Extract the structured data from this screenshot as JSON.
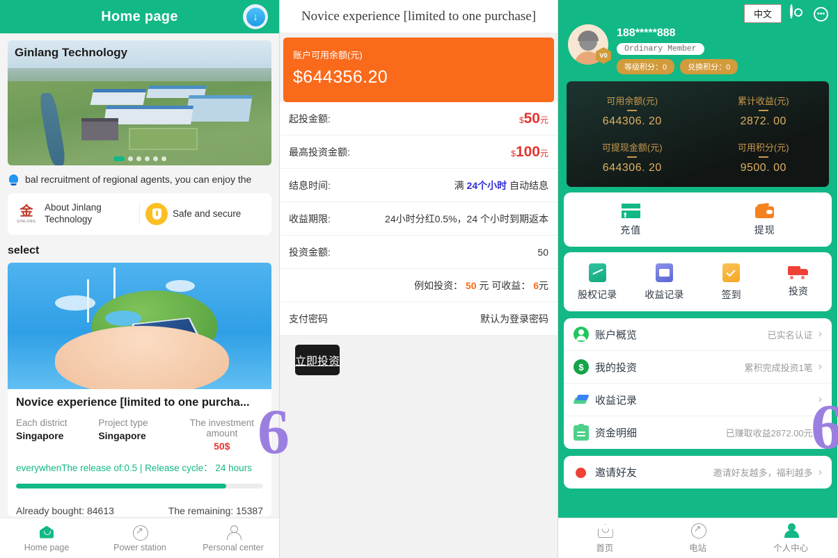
{
  "home": {
    "header_title": "Home page",
    "download_icon": "download-arrow-icon",
    "banner": {
      "logo_text": "Ginlang Technology"
    },
    "notice": {
      "icon": "bell-icon",
      "text": "bal recruitment of regional agents, you can enjoy the"
    },
    "info_items": [
      {
        "icon": "jinlang-logo-icon",
        "logo_mark": "金",
        "logo_sub": "GINLONG",
        "label": "About Jinlang Technology"
      },
      {
        "icon": "shield-icon",
        "label": "Safe and secure"
      }
    ],
    "section_title": "select",
    "product": {
      "title": "Novice experience [limited to one purcha...",
      "meta": [
        {
          "key": "Each district",
          "value": "Singapore"
        },
        {
          "key": "Project type",
          "value": "Singapore"
        },
        {
          "key": "The investment amount",
          "value": "50$"
        }
      ],
      "release_text": "everywhenThe release of:0.5 | Release cycle： 24 hours",
      "progress_percent": 85,
      "bought_label": "Already bought: 84613",
      "remaining_label": "The remaining: 15387"
    },
    "tabs": [
      {
        "label": "Home page",
        "icon": "home-icon",
        "active": true
      },
      {
        "label": "Power station",
        "icon": "power-station-icon",
        "active": false
      },
      {
        "label": "Personal center",
        "icon": "user-icon",
        "active": false
      }
    ]
  },
  "invest": {
    "header_title": "Novice experience [limited to one purchase]",
    "balance": {
      "label": "账户可用余额(元)",
      "value": "$644356.20"
    },
    "rows": [
      {
        "key": "起投金额:",
        "currency": "$",
        "number": "50",
        "unit": "元",
        "type": "amount"
      },
      {
        "key": "最高投资金额:",
        "currency": "$",
        "number": "100",
        "unit": "元",
        "type": "amount"
      },
      {
        "key": "结息时间:",
        "prefix": "满 ",
        "highlight": "24个小时",
        "suffix": " 自动结息",
        "type": "highlight-blue"
      },
      {
        "key": "收益期限:",
        "value": "24小时分红0.5%，24 个小时到期返本",
        "type": "plain"
      },
      {
        "key": "投资金额:",
        "value": "50",
        "type": "plain"
      },
      {
        "key": "",
        "prefix": "例如投资： ",
        "highlight": "50",
        "middle": " 元 可收益： ",
        "highlight2": "6",
        "suffix": "元",
        "type": "example"
      },
      {
        "key": "支付密码",
        "placeholder": "默认为登录密码",
        "type": "input"
      }
    ],
    "submit_label": "立即投资"
  },
  "profile": {
    "lang_button": "中文",
    "gear_icon": "gear-icon",
    "chat_icon": "chat-bubble-icon",
    "avatar_icon": "avatar-icon",
    "vip_badge": "V0",
    "phone": "188*****888",
    "rank": "Ordinary Member",
    "points": [
      {
        "label": "等级积分：0"
      },
      {
        "label": "兑换积分：0"
      }
    ],
    "stats": [
      {
        "key": "可用余额(元)",
        "value": "644306. 20"
      },
      {
        "key": "累计收益(元)",
        "value": "2872. 00"
      },
      {
        "key": "可提现金额(元)",
        "value": "644306. 20"
      },
      {
        "key": "可用积分(元)",
        "value": "9500. 00"
      }
    ],
    "actions": [
      {
        "label": "充值",
        "icon": "recharge-card-icon"
      },
      {
        "label": "提现",
        "icon": "withdraw-wallet-icon"
      }
    ],
    "quick_grid": [
      {
        "label": "股权记录",
        "icon": "equity-chart-icon"
      },
      {
        "label": "收益记录",
        "icon": "earnings-book-icon"
      },
      {
        "label": "签到",
        "icon": "checkin-calendar-icon"
      },
      {
        "label": "投资",
        "icon": "investment-truck-icon"
      }
    ],
    "menu": [
      {
        "label": "账户概览",
        "right": "已实名认证",
        "icon": "account-user-icon"
      },
      {
        "label": "我的投资",
        "right": "累积完成投资1笔",
        "icon": "dollar-circle-icon"
      },
      {
        "label": "收益记录",
        "right": "",
        "icon": "earnings-money-icon"
      },
      {
        "label": "资金明细",
        "right": "已赚取收益2872.00元",
        "icon": "funds-card-icon"
      },
      {
        "label": "邀请好友",
        "right": "邀请好友越多，福利越多",
        "icon": "invite-dot-icon"
      }
    ],
    "tabs": [
      {
        "label": "首页",
        "icon": "home-icon",
        "active": false
      },
      {
        "label": "电站",
        "icon": "power-station-icon",
        "active": false
      },
      {
        "label": "个人中心",
        "icon": "user-icon",
        "active": true
      }
    ]
  },
  "colors": {
    "brand_green": "#12b886",
    "orange": "#f96a1b",
    "red": "#e3342f",
    "gold": "#d29b3b",
    "dark": "#1a1a1a"
  }
}
